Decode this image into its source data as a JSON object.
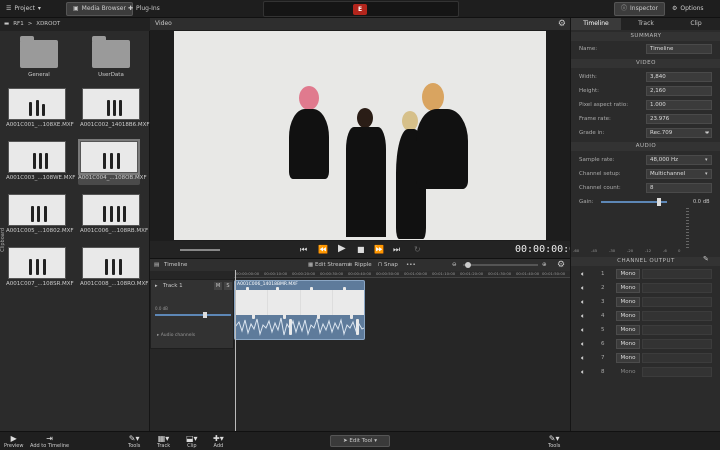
{
  "top": {
    "project": "Project",
    "media_browser": "Media Browser",
    "plugins": "Plug-Ins",
    "inspector": "Inspector",
    "options": "Options",
    "logo": "E"
  },
  "browser": {
    "crumb_root": "RF1",
    "crumb_sep": ">",
    "crumb_folder": "XDROOT",
    "folders": [
      {
        "label": "General"
      },
      {
        "label": "UserData"
      }
    ],
    "clips": [
      {
        "label": "A001C001_...108XE.MXF"
      },
      {
        "label": "A001C002_14018B6.MXF"
      },
      {
        "label": "A001C003_...108WE.MXF"
      },
      {
        "label": "A001C004_...108OB.MXF"
      },
      {
        "label": "A001C005_...10802.MXF"
      },
      {
        "label": "A001C006_...108RB.MXF"
      },
      {
        "label": "A001C007_...108SR.MXF"
      },
      {
        "label": "A001C008_...108RO.MXF"
      }
    ],
    "side_label": "Clipboard"
  },
  "video": {
    "title": "Video",
    "timecode": "00:00:00:00"
  },
  "timeline": {
    "title": "Timeline",
    "edit_streams": "Edit Streams",
    "ripple": "Ripple",
    "snap": "Snap",
    "ruler": [
      "00:00:00:00",
      "00:00:10:00",
      "00:00:20:00",
      "00:00:30:00",
      "00:00:40:00",
      "00:00:50:00",
      "00:01:00:00",
      "00:01:10:00",
      "00:01:20:00",
      "00:01:30:00",
      "00:01:40:00",
      "00:01:50:00"
    ],
    "track_name": "Track 1",
    "track_m": "M",
    "track_s": "S",
    "track_gain": "0.0 dB",
    "audio_channels": "Audio channels",
    "clip_label": "A001C006_14018BMR.MXF"
  },
  "inspector": {
    "tabs": [
      "Timeline",
      "Track",
      "Clip"
    ],
    "summary": "SUMMARY",
    "name_label": "Name:",
    "name_value": "Timeline",
    "video": "VIDEO",
    "video_rows": [
      {
        "k": "Width:",
        "v": "3,840"
      },
      {
        "k": "Height:",
        "v": "2,160"
      },
      {
        "k": "Pixel aspect ratio:",
        "v": "1.000"
      },
      {
        "k": "Frame rate:",
        "v": "23.976"
      },
      {
        "k": "Grade in:",
        "v": "Rec.709"
      }
    ],
    "audio": "AUDIO",
    "audio_rows": [
      {
        "k": "Sample rate:",
        "v": "48,000 Hz"
      },
      {
        "k": "Channel setup:",
        "v": "Multichannel"
      },
      {
        "k": "Channel count:",
        "v": "8"
      }
    ],
    "gain_label": "Gain:",
    "gain_value": "0.0",
    "gain_unit": "dB",
    "gain_ticks": [
      "-60",
      "-45",
      "-30",
      "-20",
      "-12",
      "-6",
      "0"
    ],
    "channel_output": "CHANNEL OUTPUT",
    "channels": [
      {
        "n": "1",
        "mode": "Mono"
      },
      {
        "n": "2",
        "mode": "Mono"
      },
      {
        "n": "3",
        "mode": "Mono"
      },
      {
        "n": "4",
        "mode": "Mono"
      },
      {
        "n": "5",
        "mode": "Mono"
      },
      {
        "n": "6",
        "mode": "Mono"
      },
      {
        "n": "7",
        "mode": "Mono"
      },
      {
        "n": "8",
        "mode": "Mono"
      }
    ]
  },
  "bottom": {
    "preview": "Preview",
    "add_to_timeline": "Add to Timeline",
    "tools_left": "Tools",
    "track": "Track",
    "clip": "Clip",
    "add": "Add",
    "edit_tool": "Edit Tool",
    "tools_right": "Tools"
  }
}
